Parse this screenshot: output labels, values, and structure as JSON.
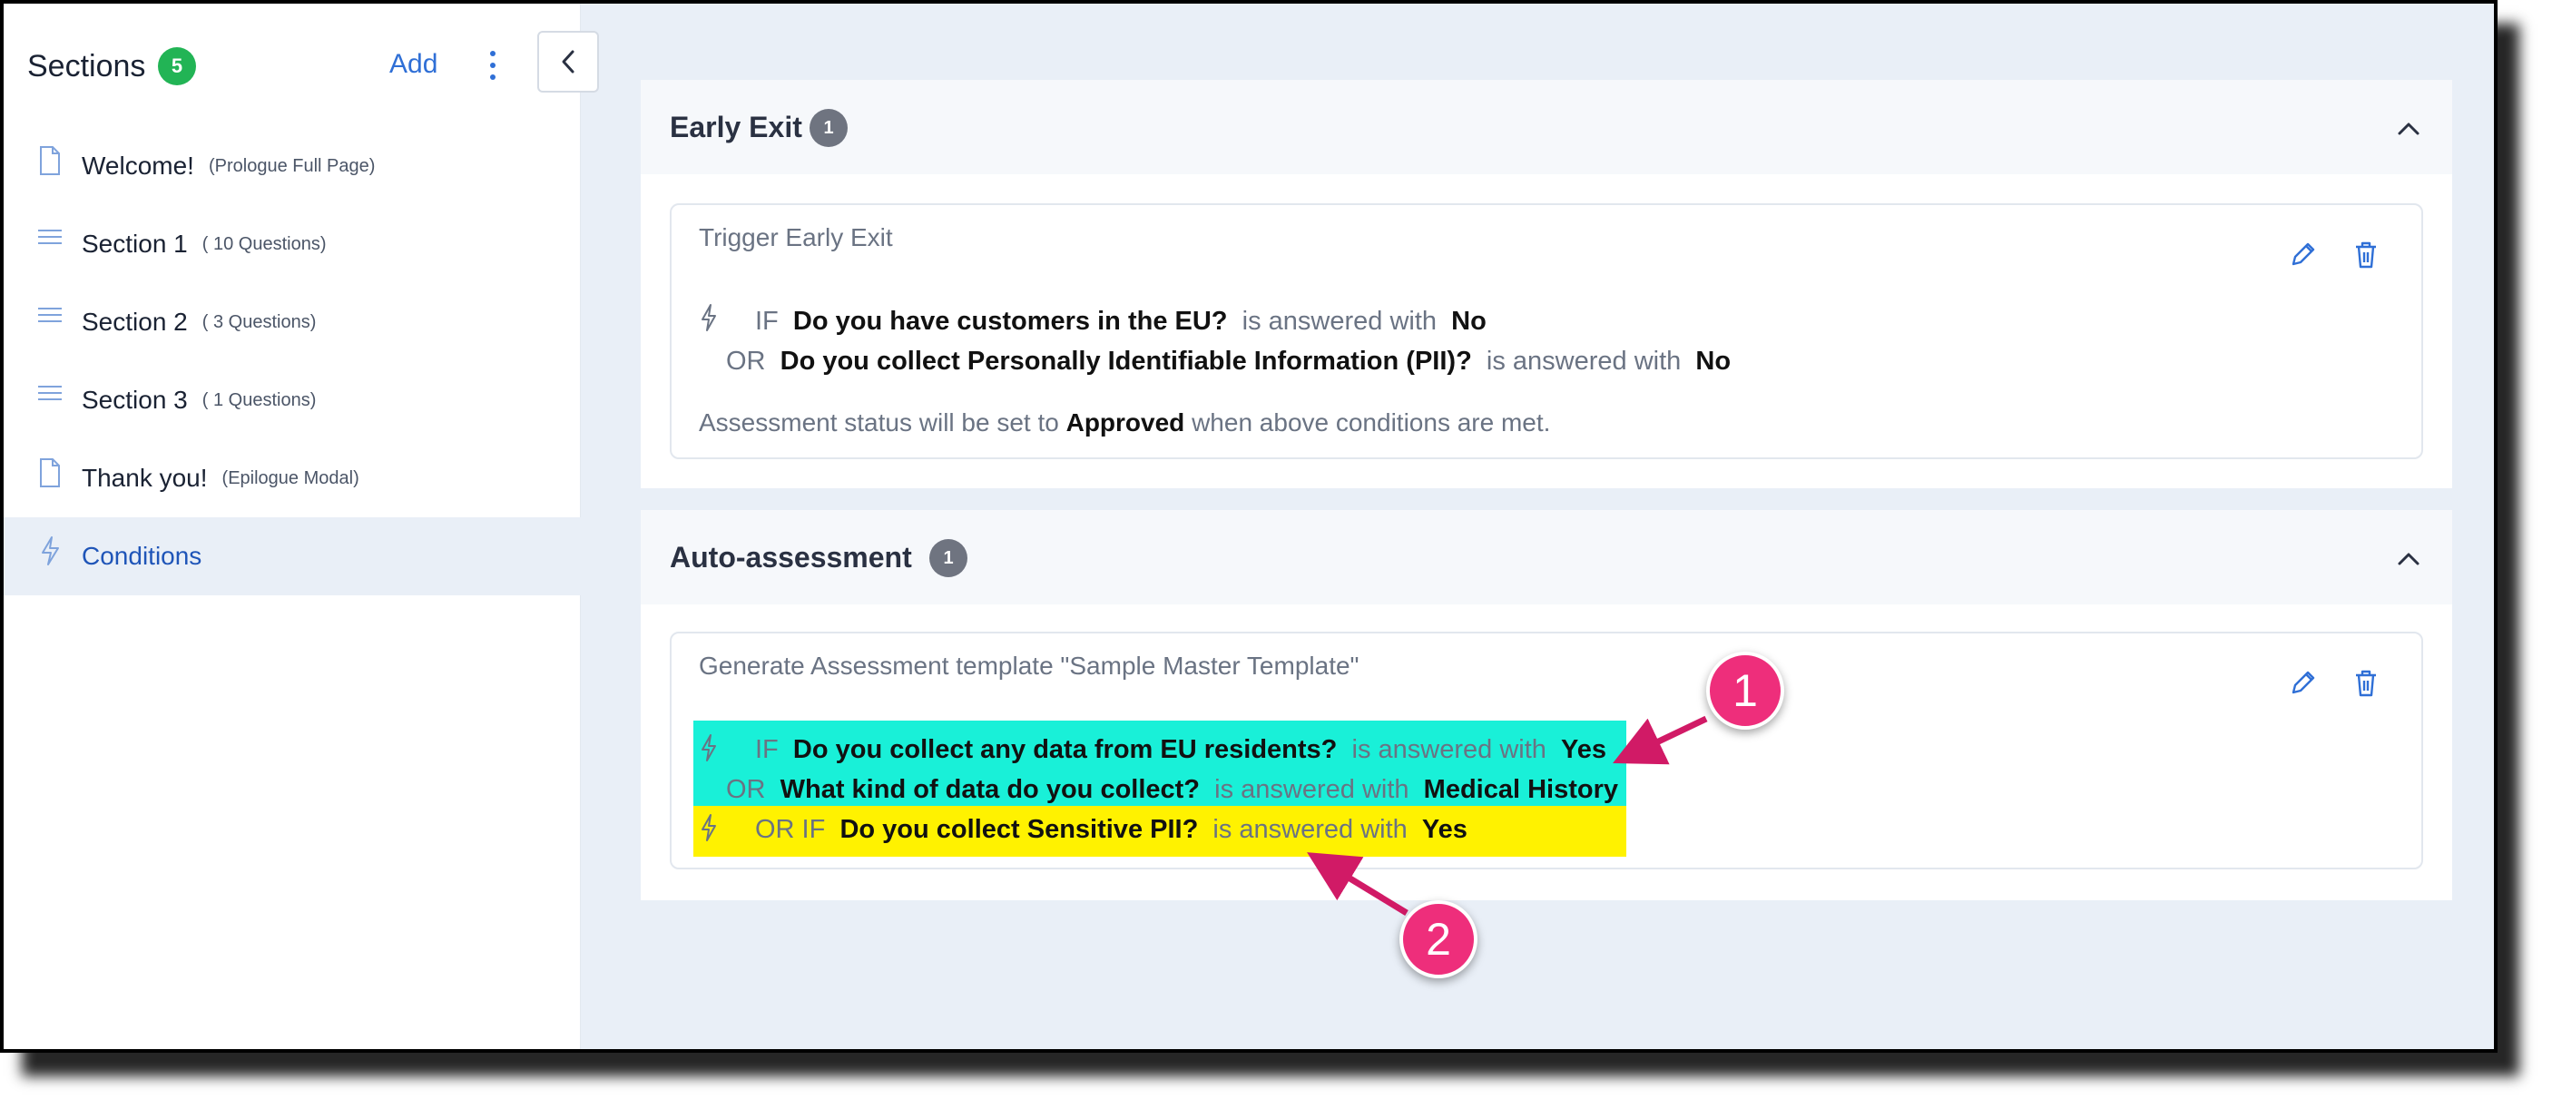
{
  "sidebar": {
    "title": "Sections",
    "count": "5",
    "add_label": "Add",
    "items": [
      {
        "label": "Welcome!",
        "sub": "(Prologue Full Page)",
        "icon": "page-icon"
      },
      {
        "label": "Section 1",
        "sub": "( 10 Questions)",
        "icon": "list-icon"
      },
      {
        "label": "Section 2",
        "sub": "( 3 Questions)",
        "icon": "list-icon"
      },
      {
        "label": "Section 3",
        "sub": "( 1 Questions)",
        "icon": "list-icon"
      },
      {
        "label": "Thank you!",
        "sub": "(Epilogue Modal)",
        "icon": "page-icon"
      },
      {
        "label": "Conditions",
        "sub": "",
        "icon": "bolt-icon",
        "active": true
      }
    ]
  },
  "panels": {
    "early_exit": {
      "title": "Early Exit",
      "badge": "1",
      "card_title": "Trigger Early Exit",
      "rows": [
        {
          "prefix": "IF",
          "question": "Do you have customers in the EU?",
          "mid": "is answered with",
          "answer": "No"
        },
        {
          "prefix": "OR",
          "question": "Do you collect Personally Identifiable Information (PII)?",
          "mid": "is answered with",
          "answer": "No"
        }
      ],
      "status_pre": "Assessment status will be set to",
      "status_value": "Approved",
      "status_post": "when above conditions are met."
    },
    "auto_assessment": {
      "title": "Auto-assessment",
      "badge": "1",
      "card_title": "Generate Assessment template \"Sample Master Template\"",
      "rows": [
        {
          "prefix": "IF",
          "question": "Do you collect any data from EU residents?",
          "mid": "is answered with",
          "answer": "Yes"
        },
        {
          "prefix": "OR",
          "question": "What kind of data do you collect?",
          "mid": "is answered with",
          "answer": "Medical History"
        },
        {
          "prefix": "OR IF",
          "question": "Do you collect Sensitive PII?",
          "mid": "is answered with",
          "answer": "Yes"
        }
      ]
    }
  },
  "callouts": [
    "1",
    "2"
  ],
  "colors": {
    "accent": "#2f6fd6",
    "count_badge": "#22b455",
    "highlight_cyan": "#19f0d8",
    "highlight_yellow": "#fff200",
    "callout": "#ee2e7b"
  }
}
